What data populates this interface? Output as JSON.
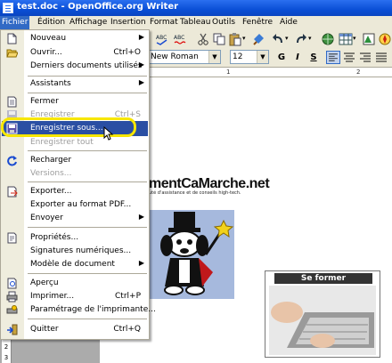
{
  "window": {
    "title": "test.doc - OpenOffice.org Writer"
  },
  "menubar": {
    "items": [
      {
        "label": "Fichier"
      },
      {
        "label": "Édition"
      },
      {
        "label": "Affichage"
      },
      {
        "label": "Insertion"
      },
      {
        "label": "Format"
      },
      {
        "label": "Tableau"
      },
      {
        "label": "Outils"
      },
      {
        "label": "Fenêtre"
      },
      {
        "label": "Aide"
      }
    ]
  },
  "formatting": {
    "font_name": "New Roman",
    "font_size": "12",
    "bold": "G",
    "italic": "I",
    "underline": "S"
  },
  "ruler": {
    "marks": [
      "1",
      "2"
    ]
  },
  "vruler": {
    "marks": [
      "1",
      "1",
      "2",
      "3"
    ]
  },
  "file_menu": {
    "items": [
      {
        "label": "Nouveau",
        "submenu": true
      },
      {
        "label": "Ouvrir...",
        "shortcut": "Ctrl+O"
      },
      {
        "label": "Derniers documents utilisés",
        "submenu": true
      },
      {
        "label": "Assistants",
        "submenu": true
      },
      {
        "label": "Fermer"
      },
      {
        "label": "Enregistrer",
        "shortcut": "Ctrl+S",
        "disabled": true
      },
      {
        "label": "Enregistrer sous...",
        "highlighted": true
      },
      {
        "label": "Enregistrer tout",
        "disabled": true
      },
      {
        "label": "Recharger"
      },
      {
        "label": "Versions...",
        "disabled": true
      },
      {
        "label": "Exporter..."
      },
      {
        "label": "Exporter au format PDF..."
      },
      {
        "label": "Envoyer",
        "submenu": true
      },
      {
        "label": "Propriétés..."
      },
      {
        "label": "Signatures numériques..."
      },
      {
        "label": "Modèle de document",
        "submenu": true
      },
      {
        "label": "Aperçu"
      },
      {
        "label": "Imprimer...",
        "shortcut": "Ctrl+P"
      },
      {
        "label": "Paramétrage de l'imprimante..."
      },
      {
        "label": "Quitter",
        "shortcut": "Ctrl+Q"
      }
    ]
  },
  "document": {
    "banner_title": "mentCaMarche.net",
    "banner_sub": "uté d'assistance et de conseils high-tech.",
    "photo_caption": "Se former"
  },
  "colors": {
    "menu_highlight": "#2a4fa3",
    "titlebar": "#0a4fd6",
    "callout": "#f7e600"
  }
}
